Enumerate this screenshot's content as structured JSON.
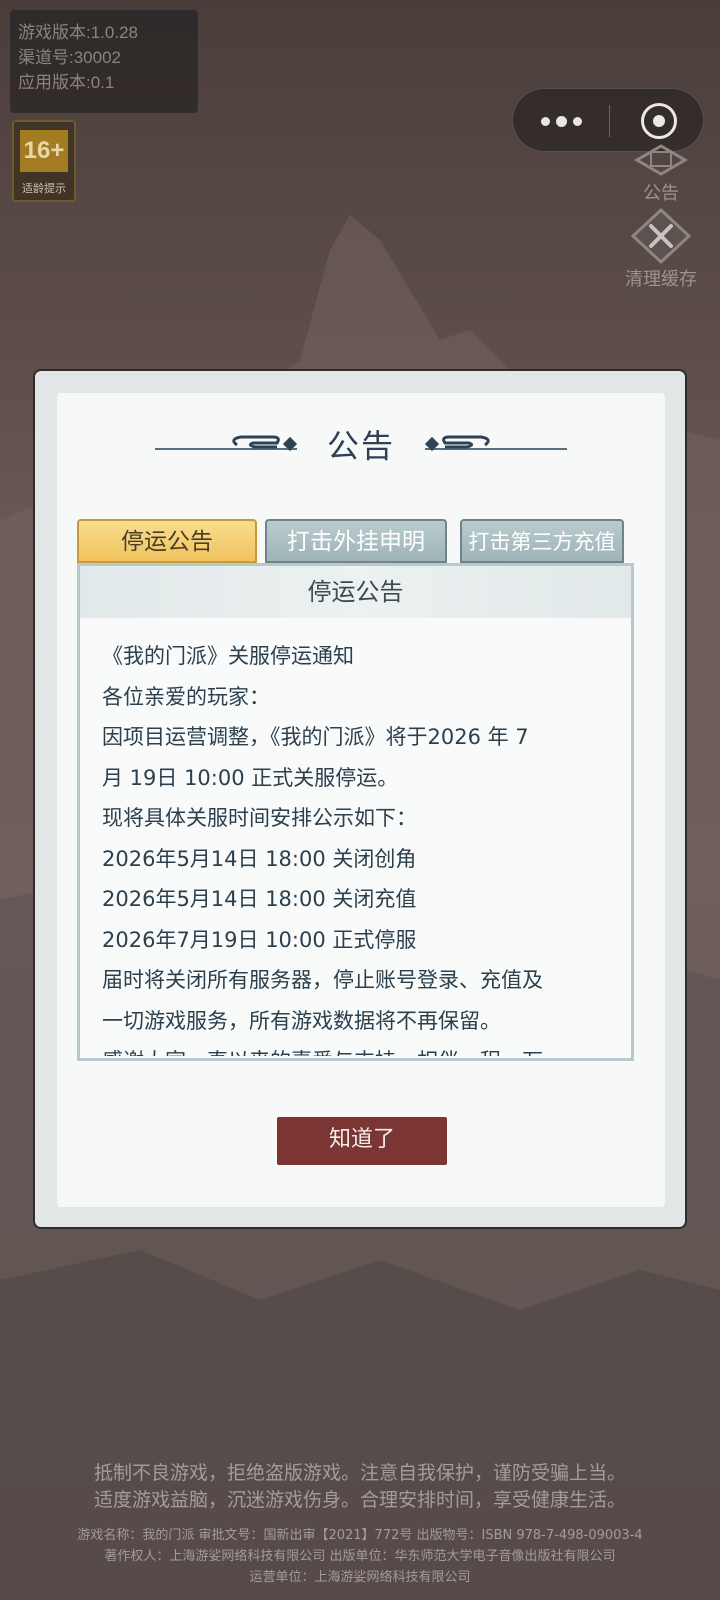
{
  "version_info": {
    "game_version": "游戏版本:1.0.28",
    "channel": "渠道号:30002",
    "app_version": "应用版本:0.1"
  },
  "age_badge": {
    "rating": "16+",
    "label": "适龄提示"
  },
  "side_buttons": {
    "notice_label": "公告",
    "clear_cache_label": "清理缓存"
  },
  "modal": {
    "title": "公告",
    "tabs": [
      {
        "label": "停运公告",
        "active": true
      },
      {
        "label": "打击外挂申明",
        "active": false
      },
      {
        "label": "打击第三方充值",
        "active": false
      }
    ],
    "content_title": "停运公告",
    "content_lines": [
      "《我的门派》关服停运通知",
      "各位亲爱的玩家：",
      "因项目运营调整，《我的门派》将于2026 年 7",
      "月 19日 10:00 正式关服停运。",
      "现将具体关服时间安排公示如下：",
      "2026年5月14日 18:00 关闭创角",
      "2026年5月14日 18:00 关闭充值",
      "2026年7月19日 10:00 正式停服",
      "届时将关闭所有服务器，停止账号登录、充值及",
      "一切游戏服务，所有游戏数据将不再保留。",
      "感谢大家一直以来的喜爱与支持，相伴一程，万"
    ],
    "ok_button": "知道了"
  },
  "footer": {
    "line1": "抵制不良游戏，拒绝盗版游戏。注意自我保护，谨防受骗上当。",
    "line2": "适度游戏益脑，沉迷游戏伤身。合理安排时间，享受健康生活。",
    "line3": "游戏名称：我的门派 审批文号：国新出审【2021】772号 出版物号：ISBN 978-7-498-09003-4",
    "line4": "著作权人：上海游娑网络科技有限公司 出版单位：华东师范大学电子音像出版社有限公司",
    "line5": "运营单位：上海游娑网络科技有限公司"
  },
  "colors": {
    "tab_active": "#f0c35d",
    "tab_inactive": "#9fb4b7",
    "ok_button": "#7b3532",
    "title_text": "#2e4254"
  }
}
